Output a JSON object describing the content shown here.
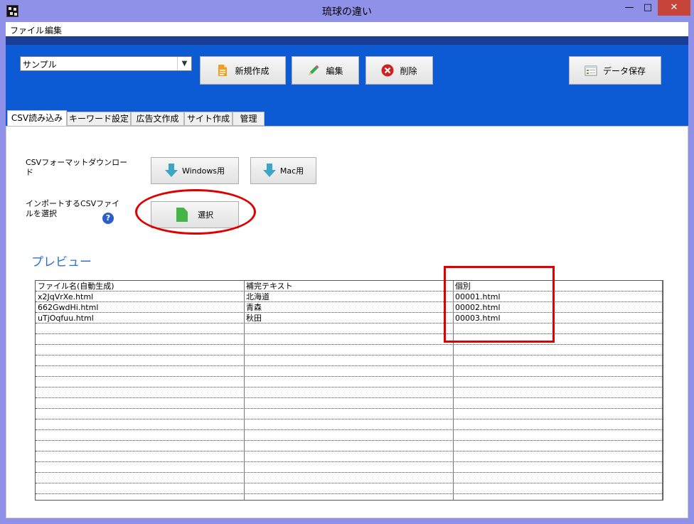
{
  "window": {
    "title": "琉球の違い",
    "minimize_glyph": "—",
    "maximize_glyph": "□",
    "close_glyph": "✕"
  },
  "menu": {
    "items": [
      "ファイル",
      "編集"
    ]
  },
  "toolbar": {
    "template_select_value": "サンプル",
    "new_label": "新規作成",
    "edit_label": "編集",
    "delete_label": "削除",
    "save_data_label": "データ保存"
  },
  "tabs": [
    "CSV読み込み",
    "キーワード設定",
    "広告文作成",
    "サイト作成",
    "管理"
  ],
  "active_tab": 0,
  "csv_panel": {
    "format_download_label_line1": "CSVフォーマットダウンロー",
    "format_download_label_line2": "ド",
    "windows_button_label": "Windows用",
    "mac_button_label": "Mac用",
    "import_label_line1": "インポートするCSVファイ",
    "import_label_line2": "ルを選択",
    "help_glyph": "?",
    "select_button_label": "選択",
    "preview_title": "プレビュー"
  },
  "preview_table": {
    "columns": [
      "ファイル名(自動生成)",
      "補完テキスト",
      "個別"
    ],
    "rows": [
      [
        "x2JqVrXe.html",
        "北海道",
        "00001.html"
      ],
      [
        "662GwdHi.html",
        "青森",
        "00002.html"
      ],
      [
        "uTjOqfuu.html",
        "秋田",
        "00003.html"
      ]
    ],
    "total_visible_rows": 20
  },
  "colors": {
    "title_bar": "#8f90e8",
    "toolbar_blue": "#0d5bd4",
    "close_button": "#c7443b",
    "highlight_red": "#e00000",
    "preview_title": "#2f6fd0"
  },
  "icons": {
    "new": "document-new-icon",
    "edit": "pencil-icon",
    "delete": "delete-x-icon",
    "save": "data-save-icon",
    "download": "download-arrow-icon",
    "select": "file-select-icon",
    "help": "help-icon"
  }
}
